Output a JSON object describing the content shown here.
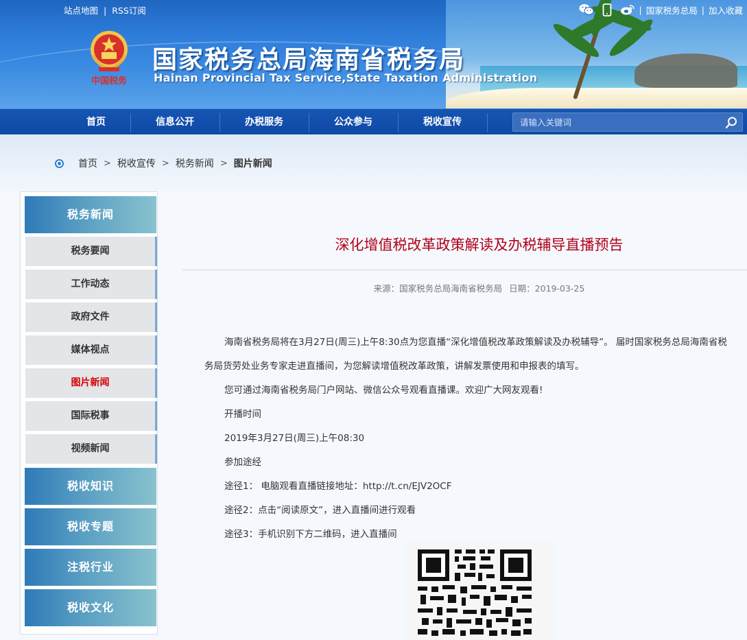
{
  "header": {
    "top_links": [
      "站点地图",
      "RSS订阅"
    ],
    "top_right_links": [
      "国家税务总局",
      "加入收藏"
    ],
    "top_right_icons": [
      "wechat-icon",
      "mobile-icon",
      "weibo-icon"
    ],
    "emblem_text": "中国税务",
    "title_cn": "国家税务总局海南省税务局",
    "title_en": "Hainan Provincial Tax Service,State Taxation Administration"
  },
  "nav": {
    "items": [
      "首页",
      "信息公开",
      "办税服务",
      "公众参与",
      "税收宣传"
    ],
    "search_placeholder": "请输入关键词"
  },
  "breadcrumb": {
    "items": [
      "首页",
      "税收宣传",
      "税务新闻"
    ],
    "current": "图片新闻"
  },
  "sidebar": {
    "section_main": "税务新闻",
    "items": [
      "税务要闻",
      "工作动态",
      "政府文件",
      "媒体视点",
      "图片新闻",
      "国际税事",
      "视频新闻"
    ],
    "active_item": "图片新闻",
    "sections_more": [
      "税收知识",
      "税收专题",
      "注税行业",
      "税收文化"
    ]
  },
  "article": {
    "title": "深化增值税改革政策解读及办税辅导直播预告",
    "meta_source": "来源：国家税务总局海南省税务局",
    "meta_date": "日期：2019-03-25",
    "para1_line1": "海南省税务局将在3月27日(周三)上午8:30点为您直播“深化增值税改革政策解读及办税辅导”。 届时国家税务总局海南省税",
    "para1_line2": "务局货劳处业务专家走进直播间，为您解读增值税改革政策，讲解发票使用和申报表的填写。",
    "para2": "您可通过海南省税务局门户网站、微信公众号观看直播课。欢迎广大网友观看!",
    "para3": "开播时间",
    "para4": "2019年3月27日(周三)上午08:30",
    "para5": "参加途经",
    "para6": "途径1： 电脑观看直播链接地址：http://t.cn/EJV2OCF",
    "para7": "途径2：点击“阅读原文”，进入直播间进行观看",
    "para8": "途径3：手机识别下方二维码，进入直播间"
  }
}
